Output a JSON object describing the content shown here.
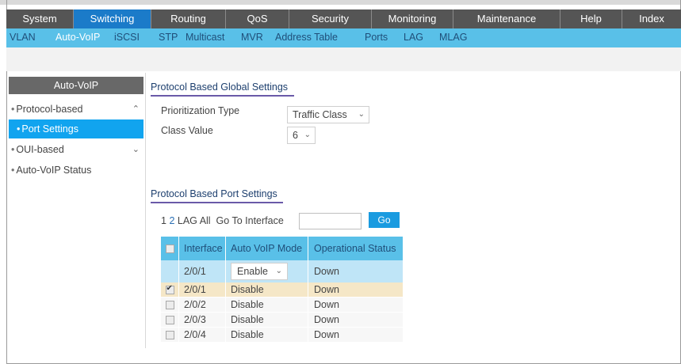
{
  "main_nav": [
    "System",
    "Switching",
    "Routing",
    "QoS",
    "Security",
    "Monitoring",
    "Maintenance",
    "Help",
    "Index"
  ],
  "main_nav_active": "Switching",
  "sub_nav": [
    "VLAN",
    "Auto-VoIP",
    "iSCSI",
    "STP",
    "Multicast",
    "MVR",
    "Address Table",
    "Ports",
    "LAG",
    "MLAG"
  ],
  "sub_nav_active": "Auto-VoIP",
  "sidebar": {
    "title": "Auto-VoIP",
    "items": [
      {
        "label": "Protocol-based",
        "chevron": "chevron-up-icon"
      },
      {
        "label": "Port Settings",
        "active": true
      },
      {
        "label": "OUI-based",
        "chevron": "chevron-down-icon"
      },
      {
        "label": "Auto-VoIP Status"
      }
    ]
  },
  "global_settings": {
    "title": "Protocol Based Global Settings",
    "prioritization_label": "Prioritization Type",
    "prioritization_value": "Traffic Class",
    "class_label": "Class Value",
    "class_value": "6"
  },
  "port_settings": {
    "title": "Protocol Based Port Settings",
    "pager": {
      "page1": "1",
      "page2": "2",
      "lag": "LAG",
      "all": "All",
      "goto_label": "Go To Interface",
      "goto_value": "",
      "go_button": "Go"
    },
    "columns": [
      "Interface",
      "Auto VoIP Mode",
      "Operational Status"
    ],
    "edit_row": {
      "interface": "2/0/1",
      "mode": "Enable",
      "status": "Down"
    },
    "rows": [
      {
        "checked": true,
        "interface": "2/0/1",
        "mode": "Disable",
        "status": "Down"
      },
      {
        "checked": false,
        "interface": "2/0/2",
        "mode": "Disable",
        "status": "Down"
      },
      {
        "checked": false,
        "interface": "2/0/3",
        "mode": "Disable",
        "status": "Down"
      },
      {
        "checked": false,
        "interface": "2/0/4",
        "mode": "Disable",
        "status": "Down"
      }
    ]
  },
  "colors": {
    "nav_bg": "#555555",
    "nav_active": "#1b7bc9",
    "subnav_bg": "#59c0e8",
    "accent": "#11a4ef",
    "selected_row": "#f5e7c7"
  }
}
